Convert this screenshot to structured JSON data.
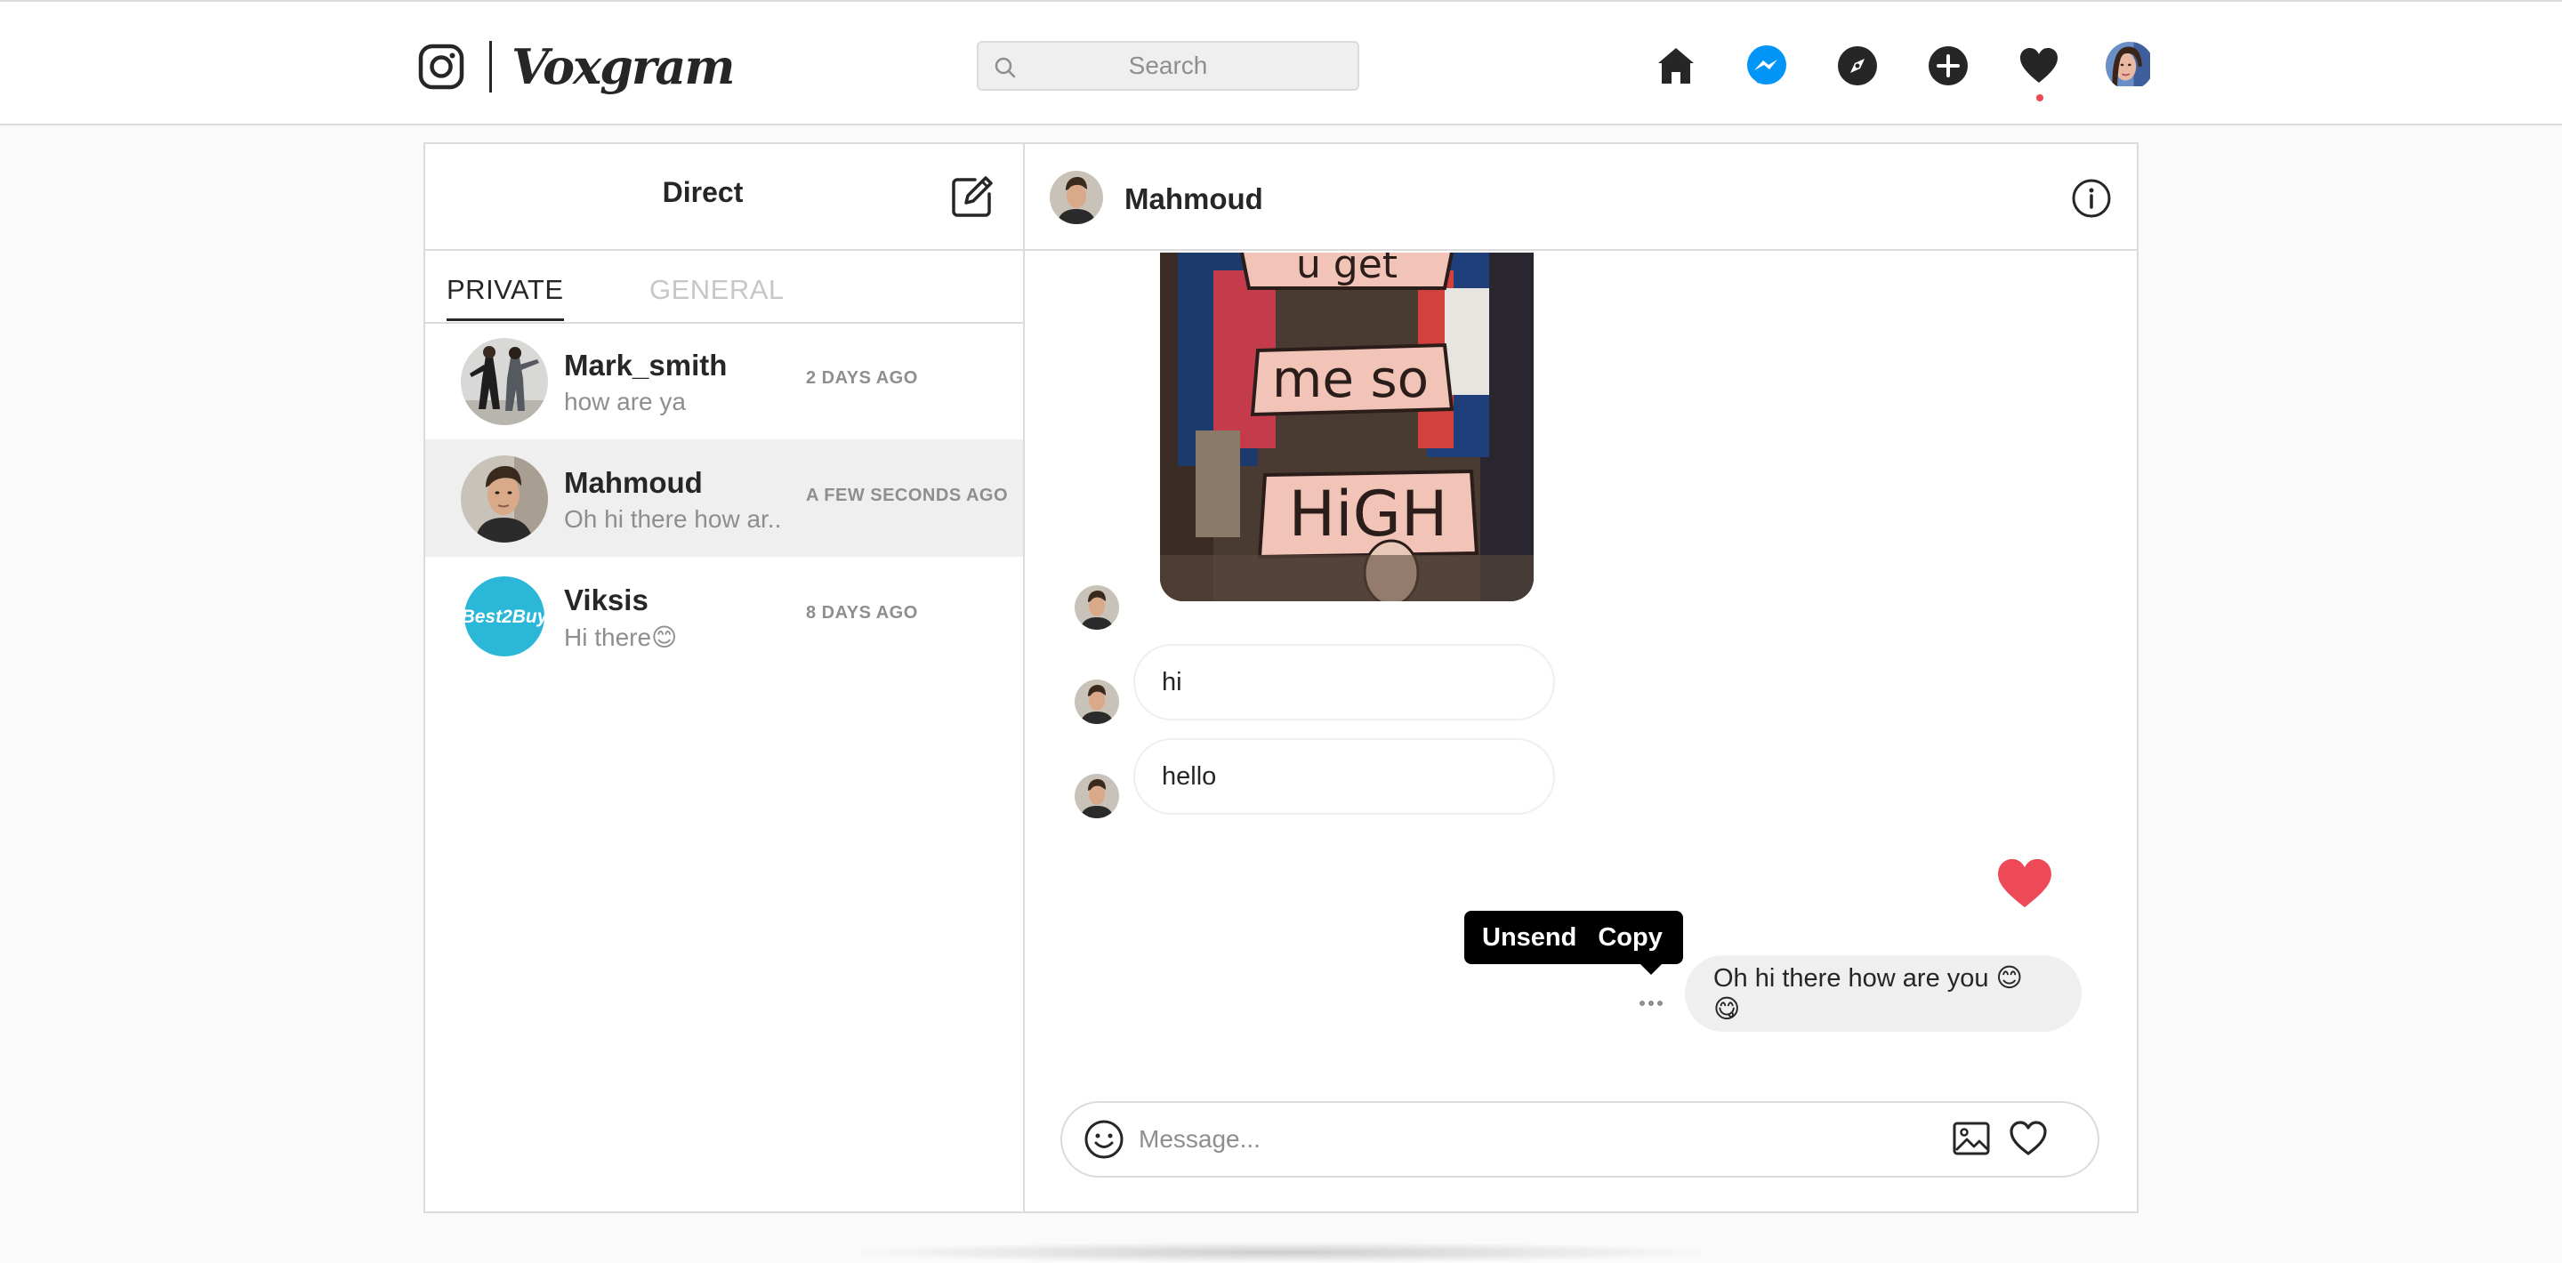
{
  "app": {
    "brand_name": "Voxgram",
    "search_placeholder": "Search"
  },
  "nav": {
    "icons": [
      "home-icon",
      "messenger-icon",
      "explore-icon",
      "new-post-icon",
      "activity-heart-icon",
      "profile-avatar"
    ],
    "messenger_color": "#0095f6",
    "notification_color": "#ed4956"
  },
  "inbox": {
    "title": "Direct",
    "tabs": [
      {
        "label": "PRIVATE",
        "active": true
      },
      {
        "label": "GENERAL",
        "active": false
      }
    ],
    "threads": [
      {
        "name": "Mark_smith",
        "preview": "how are ya",
        "time": "2 DAYS AGO",
        "selected": false
      },
      {
        "name": "Mahmoud",
        "preview": "Oh hi there how ar..",
        "time": "A FEW SECONDS AGO",
        "selected": true
      },
      {
        "name": "Viksis",
        "preview": "Hi there😊",
        "time": "8 DAYS AGO",
        "selected": false,
        "avatar_text": "Best2Buy"
      }
    ]
  },
  "conversation": {
    "contact_name": "Mahmoud",
    "photo_sign_words": [
      "u get",
      "me so",
      "HiGH"
    ],
    "messages": [
      {
        "from": "them",
        "text": "hi"
      },
      {
        "from": "them",
        "text": "hello"
      },
      {
        "from": "me",
        "text": "Oh hi there how are you 😊 😋"
      }
    ],
    "context_menu": {
      "unsend_label": "Unsend",
      "copy_label": "Copy"
    },
    "composer_placeholder": "Message...",
    "heart_color": "#ed4956"
  }
}
